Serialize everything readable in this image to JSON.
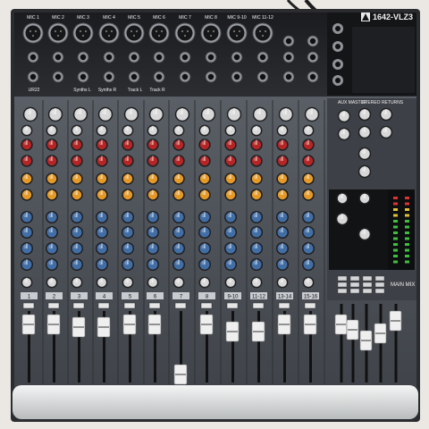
{
  "brand": {
    "model": "1642-VLZ3"
  },
  "top_panel": {
    "mic_labels": [
      "MIC 1",
      "MIC 2",
      "MIC 3",
      "MIC 4",
      "MIC 5",
      "MIC 6",
      "MIC 7",
      "MIC 8",
      "MIC 9-10",
      "MIC 11-12"
    ],
    "tape_labels": [
      "UR22",
      "Synths L",
      "Synths R",
      "Track L",
      "Track R"
    ]
  },
  "strips": {
    "channel_numbers": [
      "1",
      "2",
      "3",
      "4",
      "5",
      "6",
      "7",
      "8",
      "9-10",
      "11-12",
      "13-14",
      "15-16"
    ]
  },
  "master_section": {
    "aux_master_label": "AUX MASTER",
    "stereo_returns_label": "STEREO RETURNS",
    "main_mix_label": "MAIN MIX"
  },
  "colors": {
    "panel": "#4b4f55",
    "top_panel": "#1c1d20",
    "white_knob": "#d8d8d8",
    "red_knob": "#b62525",
    "orange_knob": "#e59a28",
    "blue_knob": "#426ea6",
    "fader_cap": "#efefef",
    "armrest": "#d7d9da"
  }
}
